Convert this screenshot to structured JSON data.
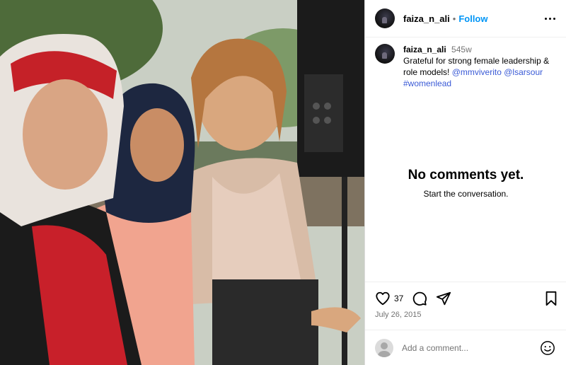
{
  "header": {
    "username": "faiza_n_ali",
    "separator": "•",
    "follow_label": "Follow"
  },
  "caption": {
    "username": "faiza_n_ali",
    "age": "545w",
    "text": "Grateful for strong female leadership & role models!",
    "mentions": [
      "@mmviverito",
      "@lsarsour"
    ],
    "hashtag": "#womenlead"
  },
  "comments": {
    "empty_title": "No comments yet.",
    "empty_subtitle": "Start the conversation."
  },
  "actions": {
    "like_count": "37",
    "date": "July 26, 2015"
  },
  "add_comment": {
    "placeholder": "Add a comment..."
  },
  "icons": {
    "more": "more-horizontal-icon",
    "like": "heart-icon",
    "comment": "comment-icon",
    "share": "send-icon",
    "save": "bookmark-icon",
    "emoji": "emoji-icon"
  },
  "colors": {
    "link_blue": "#0095f6",
    "mention_blue": "#3a5ad6",
    "muted": "#737373"
  }
}
